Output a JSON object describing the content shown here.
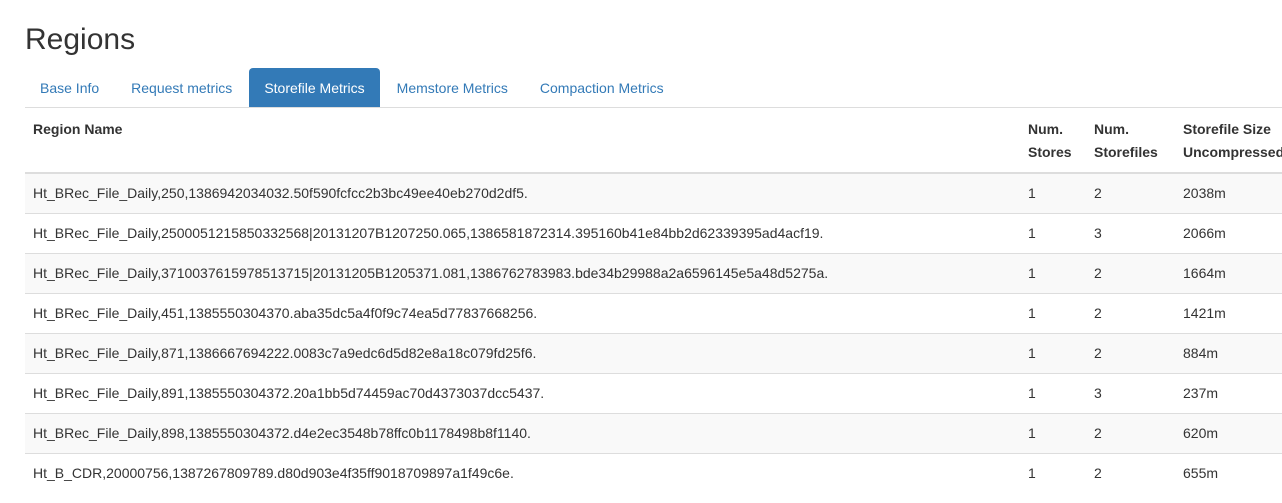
{
  "page": {
    "title": "Regions"
  },
  "tabs": [
    {
      "label": "Base Info",
      "active": false
    },
    {
      "label": "Request metrics",
      "active": false
    },
    {
      "label": "Storefile Metrics",
      "active": true
    },
    {
      "label": "Memstore Metrics",
      "active": false
    },
    {
      "label": "Compaction Metrics",
      "active": false
    }
  ],
  "table": {
    "headers": {
      "region_name": "Region Name",
      "num_stores_line1": "Num.",
      "num_stores_line2": "Stores",
      "num_storefiles_line1": "Num.",
      "num_storefiles_line2": "Storefiles",
      "storefile_size_line1": "Storefile Size",
      "storefile_size_line2": "Uncompressed"
    },
    "rows": [
      {
        "region_name": "Ht_BRec_File_Daily,250,1386942034032.50f590fcfcc2b3bc49ee40eb270d2df5.",
        "num_stores": "1",
        "num_storefiles": "2",
        "storefile_size": "2038m"
      },
      {
        "region_name": "Ht_BRec_File_Daily,2500051215850332568|20131207B1207250.065,1386581872314.395160b41e84bb2d62339395ad4acf19.",
        "num_stores": "1",
        "num_storefiles": "3",
        "storefile_size": "2066m"
      },
      {
        "region_name": "Ht_BRec_File_Daily,3710037615978513715|20131205B1205371.081,1386762783983.bde34b29988a2a6596145e5a48d5275a.",
        "num_stores": "1",
        "num_storefiles": "2",
        "storefile_size": "1664m"
      },
      {
        "region_name": "Ht_BRec_File_Daily,451,1385550304370.aba35dc5a4f0f9c74ea5d77837668256.",
        "num_stores": "1",
        "num_storefiles": "2",
        "storefile_size": "1421m"
      },
      {
        "region_name": "Ht_BRec_File_Daily,871,1386667694222.0083c7a9edc6d5d82e8a18c079fd25f6.",
        "num_stores": "1",
        "num_storefiles": "2",
        "storefile_size": "884m"
      },
      {
        "region_name": "Ht_BRec_File_Daily,891,1385550304372.20a1bb5d74459ac70d4373037dcc5437.",
        "num_stores": "1",
        "num_storefiles": "3",
        "storefile_size": "237m"
      },
      {
        "region_name": "Ht_BRec_File_Daily,898,1385550304372.d4e2ec3548b78ffc0b1178498b8f1140.",
        "num_stores": "1",
        "num_storefiles": "2",
        "storefile_size": "620m"
      },
      {
        "region_name": "Ht_B_CDR,20000756,1387267809789.d80d903e4f35ff9018709897a1f49c6e.",
        "num_stores": "1",
        "num_storefiles": "2",
        "storefile_size": "655m"
      }
    ]
  },
  "colors": {
    "link": "#337ab7",
    "active_tab_bg": "#337ab7",
    "active_tab_text": "#ffffff",
    "stripe": "#f9f9f9",
    "border": "#dddddd",
    "text": "#333333"
  }
}
